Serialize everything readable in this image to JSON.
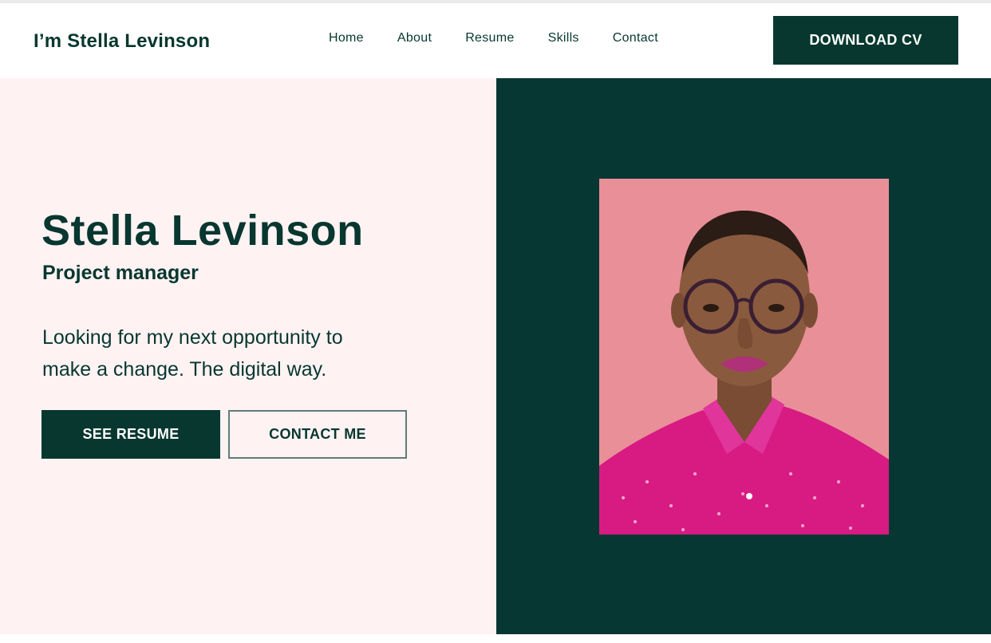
{
  "header": {
    "brand": "I’m Stella Levinson",
    "nav": [
      "Home",
      "About",
      "Resume",
      "Skills",
      "Contact"
    ],
    "download_label": "DOWNLOAD CV"
  },
  "hero": {
    "name": "Stella Levinson",
    "role": "Project manager",
    "tagline_line1": "Looking for my next opportunity to",
    "tagline_line2": "make a change. The digital way.",
    "see_resume_label": "SEE RESUME",
    "contact_label": "CONTACT ME"
  },
  "portrait": {
    "icon": "portrait-photo",
    "description_colors": {
      "background": "#e98f98",
      "shirt": "#d81b83",
      "skin": "#8a5a3e"
    }
  },
  "colors": {
    "primary": "#07372f",
    "hero_left_bg": "#fff2f3",
    "hero_right_bg": "#073732",
    "white": "#ffffff"
  }
}
